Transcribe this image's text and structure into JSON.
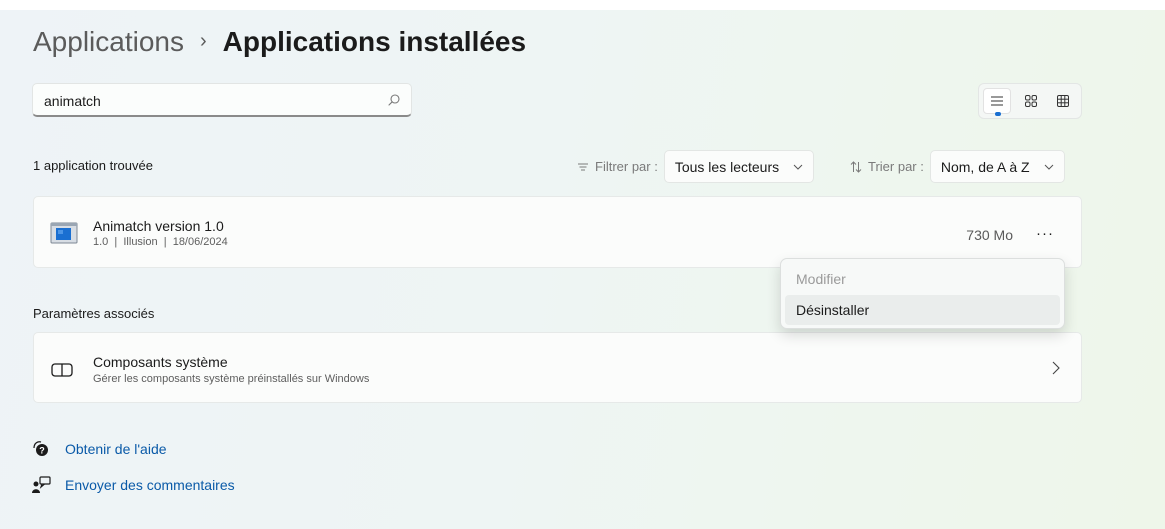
{
  "breadcrumb": {
    "parent": "Applications",
    "separator": "›",
    "current": "Applications installées"
  },
  "search": {
    "value": "animatch",
    "icon": "search-icon"
  },
  "view_modes": [
    {
      "name": "list-view",
      "icon": "list-view-icon",
      "selected": true
    },
    {
      "name": "tile-view",
      "icon": "tile-view-icon",
      "selected": false
    },
    {
      "name": "grid-view",
      "icon": "grid-view-icon",
      "selected": false
    }
  ],
  "results": {
    "count_text": "1 application trouvée"
  },
  "filter": {
    "label": "Filtrer par :",
    "value": "Tous les lecteurs",
    "icon": "filter-icon"
  },
  "sort": {
    "label": "Trier par :",
    "value": "Nom, de A à Z",
    "icon": "sort-icon"
  },
  "apps": [
    {
      "name": "Animatch version 1.0",
      "meta": "1.0  |  Illusion  |  18/06/2024",
      "size": "730 Mo",
      "more": "···"
    }
  ],
  "context_menu": {
    "items": [
      {
        "label": "Modifier",
        "enabled": false
      },
      {
        "label": "Désinstaller",
        "enabled": true,
        "highlighted": true
      }
    ]
  },
  "related": {
    "title": "Paramètres associés",
    "items": [
      {
        "name": "Composants système",
        "description": "Gérer les composants système préinstallés sur Windows"
      }
    ]
  },
  "links": [
    {
      "label": "Obtenir de l'aide",
      "icon": "help-icon"
    },
    {
      "label": "Envoyer des commentaires",
      "icon": "feedback-icon"
    }
  ],
  "colors": {
    "accent": "#1a6fd1",
    "link": "#0a5aa8"
  }
}
